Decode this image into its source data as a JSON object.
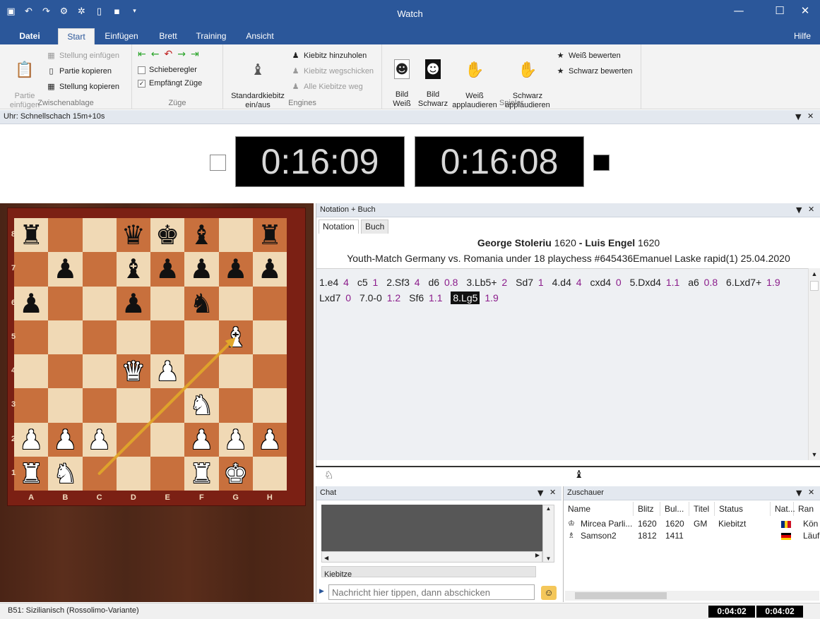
{
  "window": {
    "title": "Watch",
    "minimize_icon": "minimize-icon",
    "maximize_icon": "maximize-icon",
    "close_icon": "close-icon"
  },
  "ribbon_tabs": [
    "Datei",
    "Start",
    "Einfügen",
    "Brett",
    "Training",
    "Ansicht",
    "Hilfe"
  ],
  "ribbon": {
    "zwischenablage": {
      "label": "Zwischenablage",
      "paste": "Partie\neinfügen",
      "insert_position": "Stellung einfügen",
      "copy_game": "Partie kopieren",
      "copy_position": "Stellung kopieren"
    },
    "zuege": {
      "label": "Züge",
      "slider": "Schieberegler",
      "receives_moves": "Empfängt Züge",
      "receives_checked": true
    },
    "engines": {
      "label": "Engines",
      "standard_kibitz": "Standardkiebitz\nein/aus",
      "add_kibitz": "Kiebitz hinzuholen",
      "remove_kibitz": "Kiebitz wegschicken",
      "all_away": "Alle Kiebitze weg"
    },
    "spieler": {
      "label": "Spieler",
      "pic_white": "Bild\nWeiß",
      "pic_black": "Bild\nSchwarz",
      "applaud_white": "Weiß\napplaudieren",
      "applaud_black": "Schwarz\napplaudieren",
      "rate_white": "Weiß bewerten",
      "rate_black": "Schwarz bewerten"
    }
  },
  "clock": {
    "title": "Uhr: Schnellschach 15m+10s",
    "white_time": "0:16:09",
    "black_time": "0:16:08"
  },
  "board": {
    "files": [
      "A",
      "B",
      "C",
      "D",
      "E",
      "F",
      "G",
      "H"
    ],
    "ranks": [
      "8",
      "7",
      "6",
      "5",
      "4",
      "3",
      "2",
      "1"
    ],
    "pieces": {
      "a8": "bR",
      "d8": "bQ",
      "e8": "bK",
      "f8": "bB",
      "h8": "bR",
      "b7": "bP",
      "d7": "bB",
      "e7": "bP",
      "f7": "bP",
      "g7": "bP",
      "h7": "bP",
      "a6": "bP",
      "d6": "bP",
      "f6": "bN",
      "g5": "wB",
      "d4": "wQ",
      "e4": "wP",
      "f3": "wN",
      "a2": "wP",
      "b2": "wP",
      "c2": "wP",
      "f2": "wP",
      "g2": "wP",
      "h2": "wP",
      "a1": "wR",
      "b1": "wN",
      "f1": "wR",
      "g1": "wK"
    },
    "last_move": {
      "from": "c1",
      "to": "g5"
    }
  },
  "notation": {
    "title": "Notation + Buch",
    "tabs": [
      "Notation",
      "Buch"
    ],
    "white_player": "George Stoleriu",
    "white_elo": "1620",
    "sep": " - ",
    "black_player": "Luis Engel",
    "black_elo": "1620",
    "event": "Youth-Match Germany vs. Romania under 18 playchess #645436Emanuel Laske rapid(1) 25.04.2020",
    "moves": [
      {
        "m": "1.e4",
        "e": "4"
      },
      {
        "m": "c5",
        "e": "1"
      },
      {
        "m": "2.Sf3",
        "e": "4"
      },
      {
        "m": "d6",
        "e": "0.8"
      },
      {
        "m": "3.Lb5+",
        "e": "2"
      },
      {
        "m": "Sd7",
        "e": "1"
      },
      {
        "m": "4.d4",
        "e": "4"
      },
      {
        "m": "cxd4",
        "e": "0"
      },
      {
        "m": "5.Dxd4",
        "e": "1.1"
      },
      {
        "m": "a6",
        "e": "0.8"
      },
      {
        "m": "6.Lxd7+",
        "e": "1.9"
      },
      {
        "m": "Lxd7",
        "e": "0"
      },
      {
        "m": "7.0-0",
        "e": "1.2"
      },
      {
        "m": "Sf6",
        "e": "1.1"
      },
      {
        "m": "8.Lg5",
        "e": "1.9",
        "current": true
      }
    ]
  },
  "chat": {
    "title": "Chat",
    "tab_partial": "Kiebitze",
    "placeholder": "Nachricht hier tippen, dann abschicken"
  },
  "zuschauer": {
    "title": "Zuschauer",
    "columns": [
      "Name",
      "Blitz",
      "Bul...",
      "Titel",
      "Status",
      "Nat...",
      "Ran"
    ],
    "rows": [
      {
        "name": "Mircea Parli...",
        "blitz": "1620",
        "bullet": "1620",
        "title": "GM",
        "status": "Kiebitzt",
        "nat_colors": [
          "#002b7f",
          "#fcd116",
          "#ce1126"
        ],
        "rank": "Kön"
      },
      {
        "name": "Samson2",
        "blitz": "1812",
        "bullet": "1411",
        "title": "",
        "status": "",
        "nat_colors": [
          "#000000",
          "#dd0000",
          "#ffce00"
        ],
        "rank": "Läuf"
      }
    ]
  },
  "status": {
    "opening": "B51: Sizilianisch (Rossolimo-Variante)",
    "clock_white": "0:04:02",
    "clock_black": "0:04:02"
  }
}
